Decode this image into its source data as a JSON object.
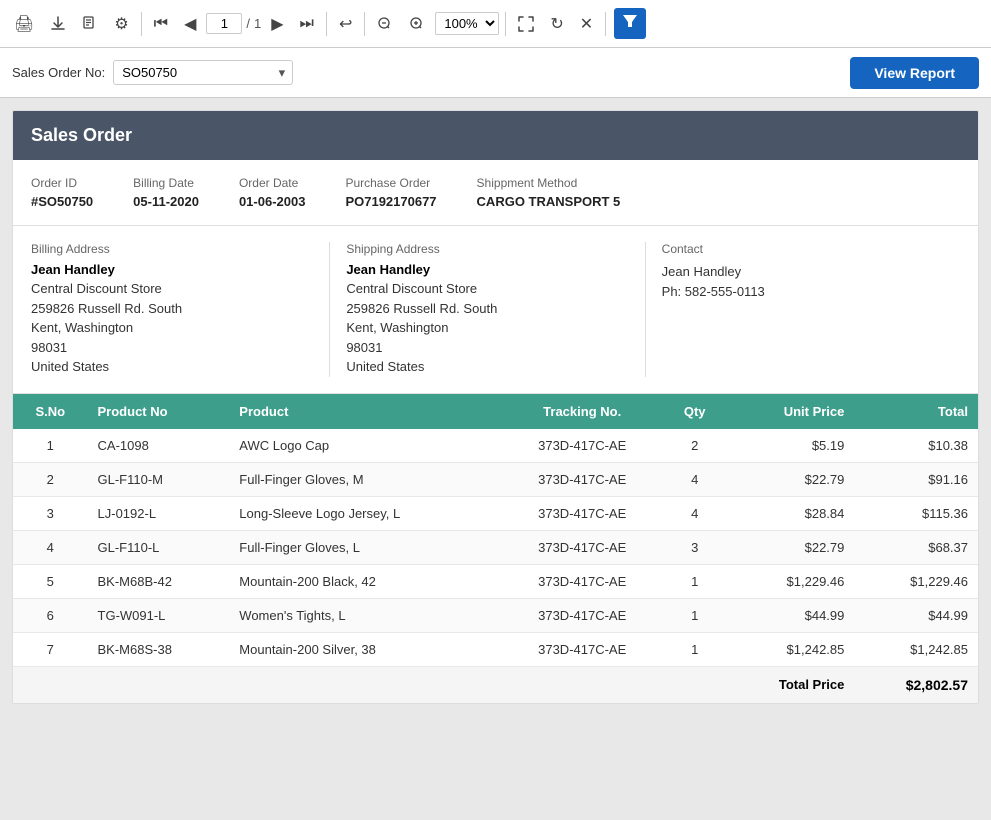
{
  "toolbar": {
    "print_label": "🖨",
    "upload_label": "⬆",
    "save_label": "💾",
    "settings_label": "⚙",
    "first_label": "⏮",
    "prev_label": "◀",
    "current_page": "1",
    "total_pages": "1",
    "next_label": "▶",
    "last_label": "⏭",
    "undo_label": "↩",
    "zoom_out_label": "🔍−",
    "zoom_in_label": "🔍+",
    "zoom_value": "100%",
    "fullscreen_label": "⛶",
    "refresh_label": "↻",
    "close_label": "✕",
    "filter_label": "▼"
  },
  "filterbar": {
    "label": "Sales Order No:",
    "selected_value": "SO50750",
    "options": [
      "SO50750"
    ],
    "view_report_label": "View Report"
  },
  "report": {
    "title": "Sales Order",
    "order_id_label": "Order ID",
    "order_id_value": "#SO50750",
    "billing_date_label": "Billing Date",
    "billing_date_value": "05-11-2020",
    "order_date_label": "Order Date",
    "order_date_value": "01-06-2003",
    "purchase_order_label": "Purchase Order",
    "purchase_order_value": "PO7192170677",
    "shipment_method_label": "Shippment Method",
    "shipment_method_value": "CARGO TRANSPORT 5",
    "billing_address_label": "Billing Address",
    "billing_name": "Jean Handley",
    "billing_company": "Central Discount Store",
    "billing_street": "259826 Russell Rd. South",
    "billing_city": "Kent, Washington",
    "billing_zip": "98031",
    "billing_country": "United States",
    "shipping_address_label": "Shipping Address",
    "shipping_name": "Jean Handley",
    "shipping_company": "Central Discount Store",
    "shipping_street": "259826 Russell Rd. South",
    "shipping_city": "Kent, Washington",
    "shipping_zip": "98031",
    "shipping_country": "United States",
    "contact_label": "Contact",
    "contact_name": "Jean Handley",
    "contact_phone": "Ph: 582-555-0113",
    "columns": [
      "S.No",
      "Product No",
      "Product",
      "Tracking No.",
      "Qty",
      "Unit Price",
      "Total"
    ],
    "rows": [
      {
        "sno": 1,
        "product_no": "CA-1098",
        "product": "AWC Logo Cap",
        "tracking": "373D-417C-AE",
        "qty": 2,
        "unit_price": "$5.19",
        "total": "$10.38"
      },
      {
        "sno": 2,
        "product_no": "GL-F110-M",
        "product": "Full-Finger Gloves, M",
        "tracking": "373D-417C-AE",
        "qty": 4,
        "unit_price": "$22.79",
        "total": "$91.16"
      },
      {
        "sno": 3,
        "product_no": "LJ-0192-L",
        "product": "Long-Sleeve Logo Jersey, L",
        "tracking": "373D-417C-AE",
        "qty": 4,
        "unit_price": "$28.84",
        "total": "$115.36"
      },
      {
        "sno": 4,
        "product_no": "GL-F110-L",
        "product": "Full-Finger Gloves, L",
        "tracking": "373D-417C-AE",
        "qty": 3,
        "unit_price": "$22.79",
        "total": "$68.37"
      },
      {
        "sno": 5,
        "product_no": "BK-M68B-42",
        "product": "Mountain-200 Black, 42",
        "tracking": "373D-417C-AE",
        "qty": 1,
        "unit_price": "$1,229.46",
        "total": "$1,229.46"
      },
      {
        "sno": 6,
        "product_no": "TG-W091-L",
        "product": "Women's Tights, L",
        "tracking": "373D-417C-AE",
        "qty": 1,
        "unit_price": "$44.99",
        "total": "$44.99"
      },
      {
        "sno": 7,
        "product_no": "BK-M68S-38",
        "product": "Mountain-200 Silver, 38",
        "tracking": "373D-417C-AE",
        "qty": 1,
        "unit_price": "$1,242.85",
        "total": "$1,242.85"
      }
    ],
    "total_price_label": "Total Price",
    "total_price_value": "$2,802.57"
  }
}
